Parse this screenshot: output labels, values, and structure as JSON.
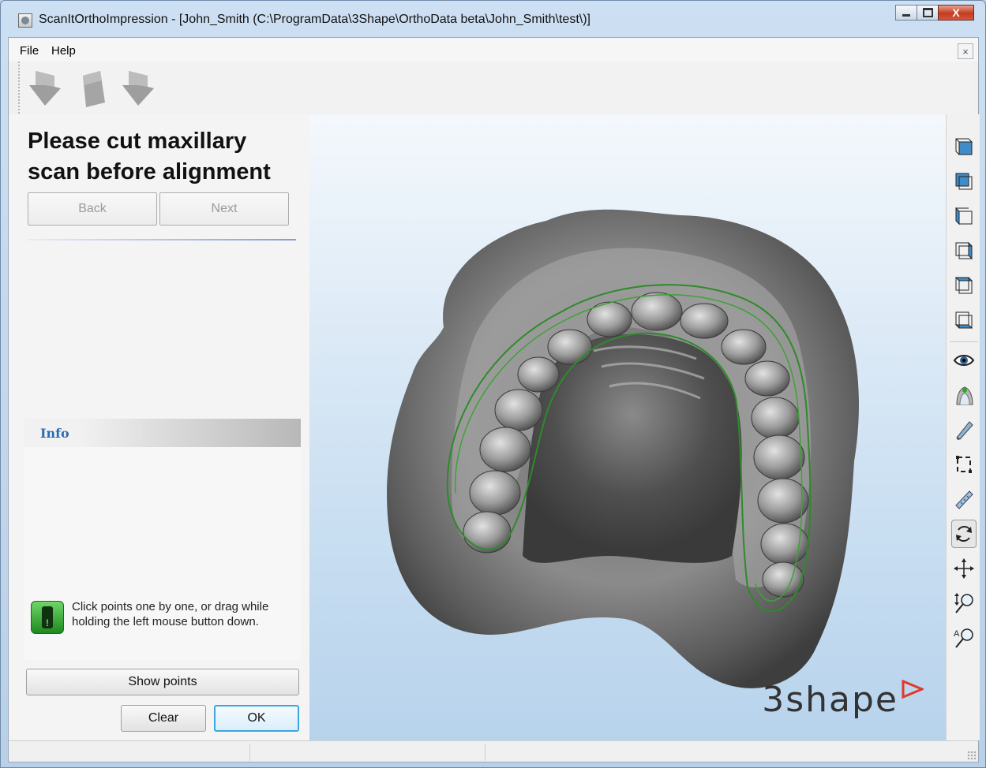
{
  "window": {
    "title": "ScanItOrthoImpression - [John_Smith (C:\\ProgramData\\3Shape\\OrthoData beta\\John_Smith\\test\\)]"
  },
  "menu": {
    "file": "File",
    "help": "Help",
    "close_symbol": "×"
  },
  "toolbar": {
    "icons": [
      "arrow-down-icon",
      "page-icon",
      "arrow-down-icon"
    ]
  },
  "left_panel": {
    "title": "Please cut maxillary scan before alignment",
    "back_label": "Back",
    "next_label": "Next",
    "info_header": "Info",
    "hint": "Click points one by one, or drag while holding the left mouse button down.",
    "show_points_label": "Show points",
    "clear_label": "Clear",
    "ok_label": "OK"
  },
  "viewport": {
    "brand": "3shape",
    "background_top": "#f4f8fc",
    "background_bottom": "#b7d3ec",
    "cut_line_color": "#2f8a2a"
  },
  "right_toolbar": {
    "icons": [
      "view-front-icon",
      "view-back-icon",
      "view-left-icon",
      "view-right-icon",
      "view-top-icon",
      "view-bottom-icon",
      "eye-icon",
      "model-icon",
      "pencil-icon",
      "crop-icon",
      "measure-icon",
      "rotate-icon",
      "pan-icon",
      "zoom-icon",
      "auto-zoom-icon"
    ]
  },
  "colors": {
    "accent": "#3aa7e0",
    "info_header_text": "#2b6cb3",
    "hint_icon": "#2fa82c"
  }
}
